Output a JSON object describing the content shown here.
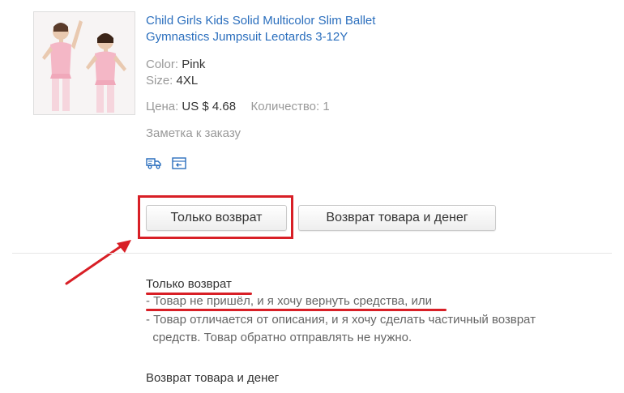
{
  "product": {
    "title": "Child Girls Kids Solid Multicolor Slim Ballet Gymnastics Jumpsuit Leotards 3-12Y",
    "color_label": "Color:",
    "color_value": "Pink",
    "size_label": "Size:",
    "size_value": "4XL",
    "price_label": "Цена:",
    "price_value": "US $ 4.68",
    "qty_label": "Количество:",
    "qty_value": "1",
    "order_note": "Заметка к заказу",
    "icons": [
      "shipping-truck-icon",
      "return-box-icon"
    ]
  },
  "buttons": {
    "refund_only": "Только возврат",
    "return_and_refund": "Возврат товара и денег"
  },
  "info": {
    "refund_only_title": "Только возврат",
    "refund_only_lines": [
      "- Товар не пришёл, и я хочу вернуть средства, или",
      "- Товар отличается от описания, и я хочу сделать частичный возврат",
      "  средств. Товар обратно отправлять не нужно."
    ],
    "return_refund_title": "Возврат товара и денег"
  },
  "colors": {
    "link": "#2a6ebd",
    "annotation_red": "#d81f26"
  }
}
